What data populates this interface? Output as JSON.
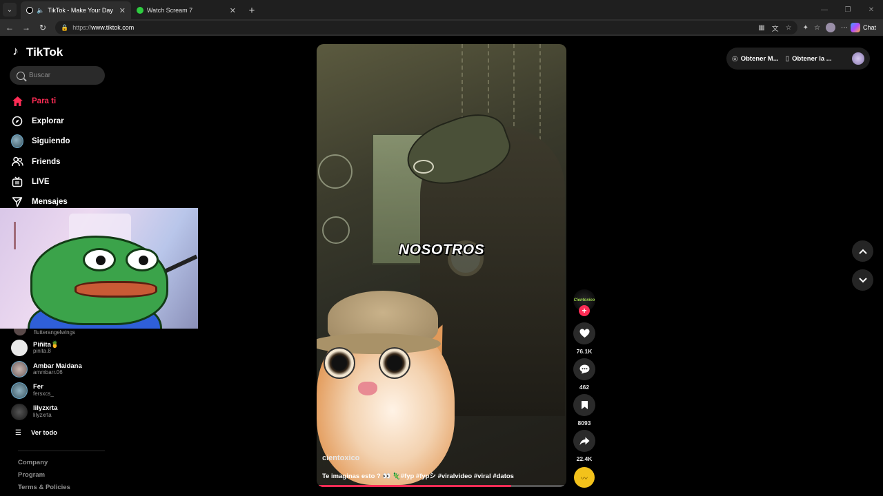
{
  "browser": {
    "tabs": [
      {
        "title": "TikTok - Make Your Day",
        "favicon_color": "#000000",
        "active": true
      },
      {
        "title": "Watch Scream 7",
        "favicon_color": "#2ecc40",
        "active": false
      }
    ],
    "url_prefix": "https://",
    "url_domain": "www.tiktok.com",
    "chat_label": "Chat"
  },
  "sidebar": {
    "logo_text": "TikTok",
    "search_placeholder": "Buscar",
    "nav": [
      {
        "label": "Para ti",
        "icon": "home-icon"
      },
      {
        "label": "Explorar",
        "icon": "compass-icon"
      },
      {
        "label": "Siguiendo",
        "icon": "avatar"
      },
      {
        "label": "Friends",
        "icon": "friends-icon"
      },
      {
        "label": "LIVE",
        "icon": "live-icon"
      },
      {
        "label": "Mensajes",
        "icon": "send-icon"
      }
    ],
    "accounts": [
      {
        "name": "",
        "handle": "flutterangelwings"
      },
      {
        "name": "Piñita🍍",
        "handle": "pinita.8"
      },
      {
        "name": "Ambar Maidana",
        "handle": "ammbarr.06"
      },
      {
        "name": "Fer",
        "handle": "fersxcs_"
      },
      {
        "name": "lilyzxrta",
        "handle": "lilyzxrta"
      }
    ],
    "see_all": "Ver todo",
    "footer": [
      "Company",
      "Program",
      "Terms & Policies"
    ]
  },
  "video": {
    "overlay_text": "NOSOTROS",
    "author": "cientoxico",
    "caption": "Te imaginas esto ? 👀 🦎#fyp #fypシ #viralvideo #viral #datos",
    "progress": 0.78,
    "accent": "#fe2c55"
  },
  "actions": {
    "creator_badge": "Cientoxico",
    "likes": "76.1K",
    "comments": "462",
    "saves": "8093",
    "shares": "22.4K"
  },
  "top_right": {
    "item1": "Obtener M...",
    "item2": "Obtener la ..."
  }
}
